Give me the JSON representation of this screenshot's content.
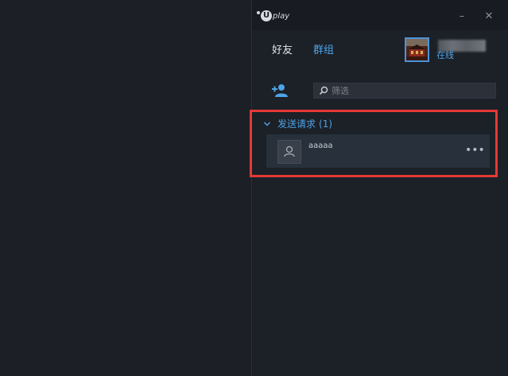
{
  "app": {
    "logo_text": "Uplay",
    "logo_mark": "U",
    "logo_wordmark": "play"
  },
  "window_controls": {
    "minimize_icon": "minimize-icon",
    "close_icon": "close-icon",
    "minimize_glyph": "–",
    "close_glyph": "✕"
  },
  "tabs": [
    {
      "label": "好友",
      "active": true
    },
    {
      "label": "群组",
      "active": false
    }
  ],
  "profile": {
    "status": "在线",
    "avatar_icon": "user-avatar-image"
  },
  "toolbar": {
    "add_friend_icon": "add-friend-icon",
    "filter_placeholder": "筛选",
    "search_icon": "search-icon"
  },
  "sections": [
    {
      "title": "发送请求",
      "count": "(1)",
      "expanded": true,
      "items": [
        {
          "name": "aaaaa",
          "more_glyph": "•••"
        }
      ]
    }
  ],
  "colors": {
    "accent": "#4ea3e6",
    "highlight": "#e53935",
    "background": "#1c1f26"
  }
}
